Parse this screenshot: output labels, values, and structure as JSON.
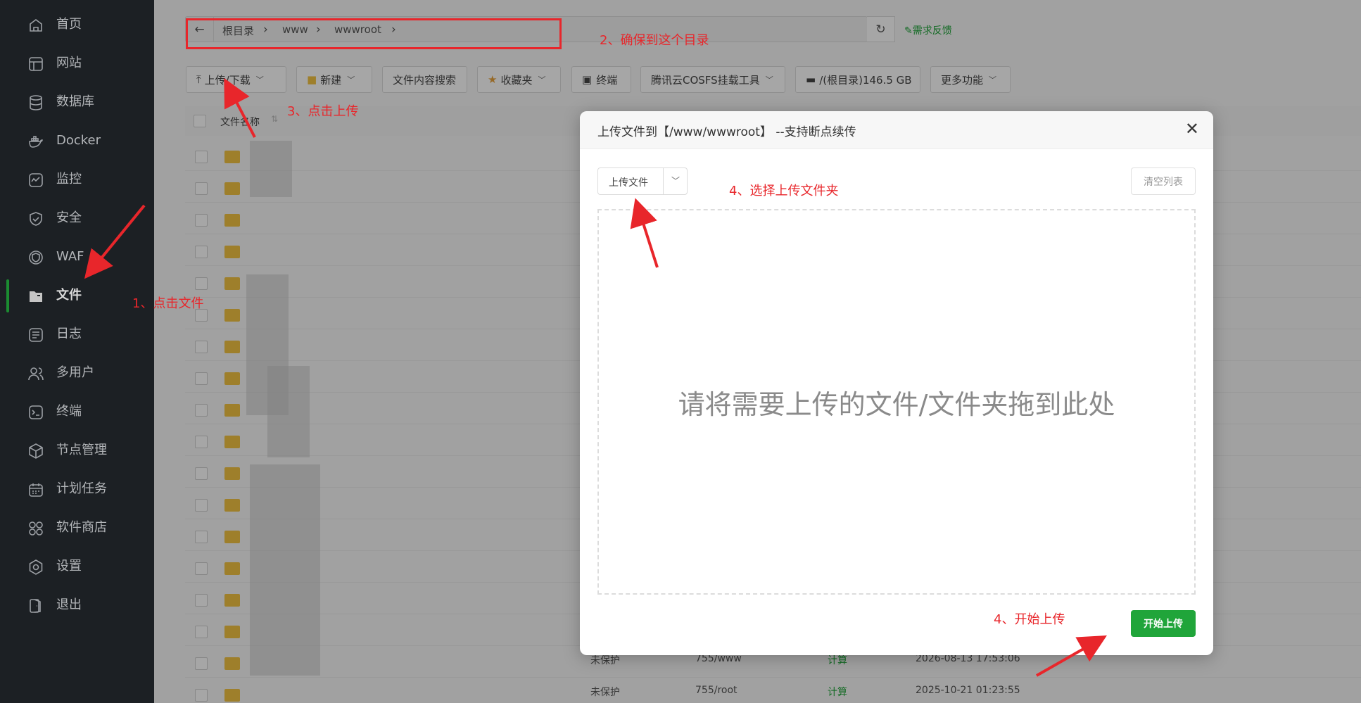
{
  "sidebar": {
    "items": [
      {
        "label": "首页",
        "icon": "home-icon"
      },
      {
        "label": "网站",
        "icon": "globe-icon"
      },
      {
        "label": "数据库",
        "icon": "database-icon"
      },
      {
        "label": "Docker",
        "icon": "docker-icon"
      },
      {
        "label": "监控",
        "icon": "monitor-icon"
      },
      {
        "label": "安全",
        "icon": "shield-icon"
      },
      {
        "label": "WAF",
        "icon": "waf-icon"
      },
      {
        "label": "文件",
        "icon": "folder-icon",
        "active": true
      },
      {
        "label": "日志",
        "icon": "log-icon"
      },
      {
        "label": "多用户",
        "icon": "users-icon"
      },
      {
        "label": "终端",
        "icon": "terminal-icon"
      },
      {
        "label": "节点管理",
        "icon": "node-icon"
      },
      {
        "label": "计划任务",
        "icon": "calendar-icon"
      },
      {
        "label": "软件商店",
        "icon": "store-icon"
      },
      {
        "label": "设置",
        "icon": "gear-icon"
      },
      {
        "label": "退出",
        "icon": "logout-icon"
      }
    ]
  },
  "breadcrumb": {
    "root": "根目录",
    "p1": "www",
    "p2": "wwwroot"
  },
  "feedback": "需求反馈",
  "toolbar": {
    "upload": "上传/下载",
    "new": "新建",
    "search": "文件内容搜索",
    "favorites": "收藏夹",
    "terminal": "终端",
    "cosfs": "腾讯云COSFS挂载工具",
    "disk": "/(根目录)146.5 GB",
    "more": "更多功能"
  },
  "table": {
    "col_name": "文件名称",
    "rows": [
      {
        "perm": "未保护",
        "owner": "755/www",
        "size": "计算",
        "time": "2026-08-13 17:53:06"
      },
      {
        "perm": "未保护",
        "owner": "755/root",
        "size": "计算",
        "time": "2025-10-21 01:23:55"
      }
    ]
  },
  "modal": {
    "title": "上传文件到【/www/wwwroot】 --支持断点续传",
    "upload_file": "上传文件",
    "clear_list": "清空列表",
    "drop_hint": "请将需要上传的文件/文件夹拖到此处",
    "start_upload": "开始上传"
  },
  "annotations": {
    "a1": "1、点击文件",
    "a2": "2、确保到这个目录",
    "a3": "3、点击上传",
    "a4": "4、选择上传文件夹",
    "a5": "4、开始上传"
  },
  "colors": {
    "accent": "#20a53a",
    "annotation": "#e8262b",
    "sidebar": "#22262b"
  }
}
